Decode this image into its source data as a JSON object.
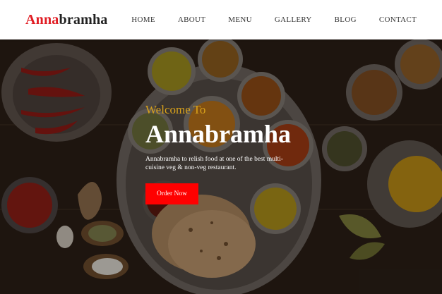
{
  "brand": {
    "accent": "Anna",
    "rest": "bramha",
    "accent_color": "#e01b22"
  },
  "nav": {
    "items": [
      {
        "label": "HOME"
      },
      {
        "label": "ABOUT"
      },
      {
        "label": "MENU"
      },
      {
        "label": "GALLERY"
      },
      {
        "label": "BLOG"
      },
      {
        "label": "CONTACT"
      }
    ]
  },
  "hero": {
    "welcome": "Welcome To",
    "title": "Annabramha",
    "description": "Annabramha to relish food at one of the best multi-cuisine veg & non-veg restaurant.",
    "button_label": "Order Now",
    "button_color": "#ff0000",
    "welcome_color": "#d9a21b"
  }
}
